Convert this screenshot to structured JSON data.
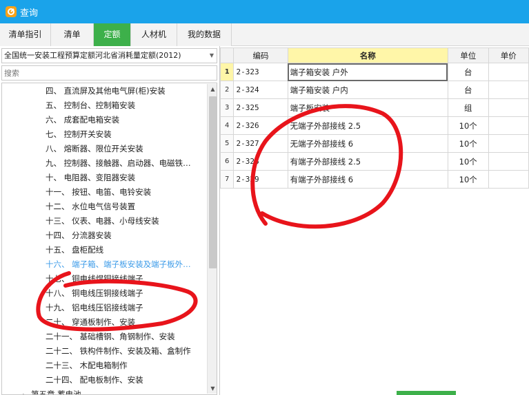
{
  "window": {
    "title": "查询"
  },
  "tabs": [
    {
      "label": "清单指引"
    },
    {
      "label": "清单"
    },
    {
      "label": "定额",
      "active": true
    },
    {
      "label": "人材机"
    },
    {
      "label": "我的数据"
    }
  ],
  "left": {
    "quota_library": "全国统一安装工程预算定额河北省消耗量定额(2012)",
    "search_placeholder": "搜索",
    "tree_items": [
      "四、 直流屏及其他电气屏(柜)安装",
      "五、 控制台、控制箱安装",
      "六、 成套配电箱安装",
      "七、 控制开关安装",
      "八、 熔断器、限位开关安装",
      "九、 控制器、接触器、启动器、电磁铁…",
      "十、 电阻器、变阻器安装",
      "十一、 按钮、电笛、电铃安装",
      "十二、 水位电气信号装置",
      "十三、 仪表、电器、小母线安装",
      "十四、 分流器安装",
      "十五、 盘柜配线",
      "十六、 端子箱、端子板安装及端子板外…",
      "十七、 铜电线焊铜接线端子",
      "十八、 铜电线压铜接线端子",
      "十九、 铝电线压铝接线端子",
      "二十、 穿通板制作、安装",
      "二十一、 基础槽钢、角钢制作、安装",
      "二十二、 铁构件制作、安装及箱、盒制作",
      "二十三、 木配电箱制作",
      "二十四、 配电板制作、安装"
    ],
    "selected_index": 12,
    "chapter_item": "第五章 蓄电池"
  },
  "grid": {
    "columns": [
      "",
      "编码",
      "名称",
      "单位",
      "单价"
    ],
    "rows": [
      {
        "idx": "1",
        "code": "2-323",
        "name": "端子箱安装 户外",
        "unit": "台"
      },
      {
        "idx": "2",
        "code": "2-324",
        "name": "端子箱安装 户内",
        "unit": "台"
      },
      {
        "idx": "3",
        "code": "2-325",
        "name": "端子板安装",
        "unit": "组"
      },
      {
        "idx": "4",
        "code": "2-326",
        "name": "无端子外部接线 2.5",
        "unit": "10个"
      },
      {
        "idx": "5",
        "code": "2-327",
        "name": "无端子外部接线 6",
        "unit": "10个"
      },
      {
        "idx": "6",
        "code": "2-328",
        "name": "有端子外部接线 2.5",
        "unit": "10个"
      },
      {
        "idx": "7",
        "code": "2-329",
        "name": "有端子外部接线 6",
        "unit": "10个"
      }
    ]
  },
  "colors": {
    "titlebar": "#1aa3ea",
    "active_tab": "#3db04a",
    "selected_tree": "#3c9be8",
    "annotation": "#e8141b",
    "header_highlight": "#fff6a8"
  }
}
